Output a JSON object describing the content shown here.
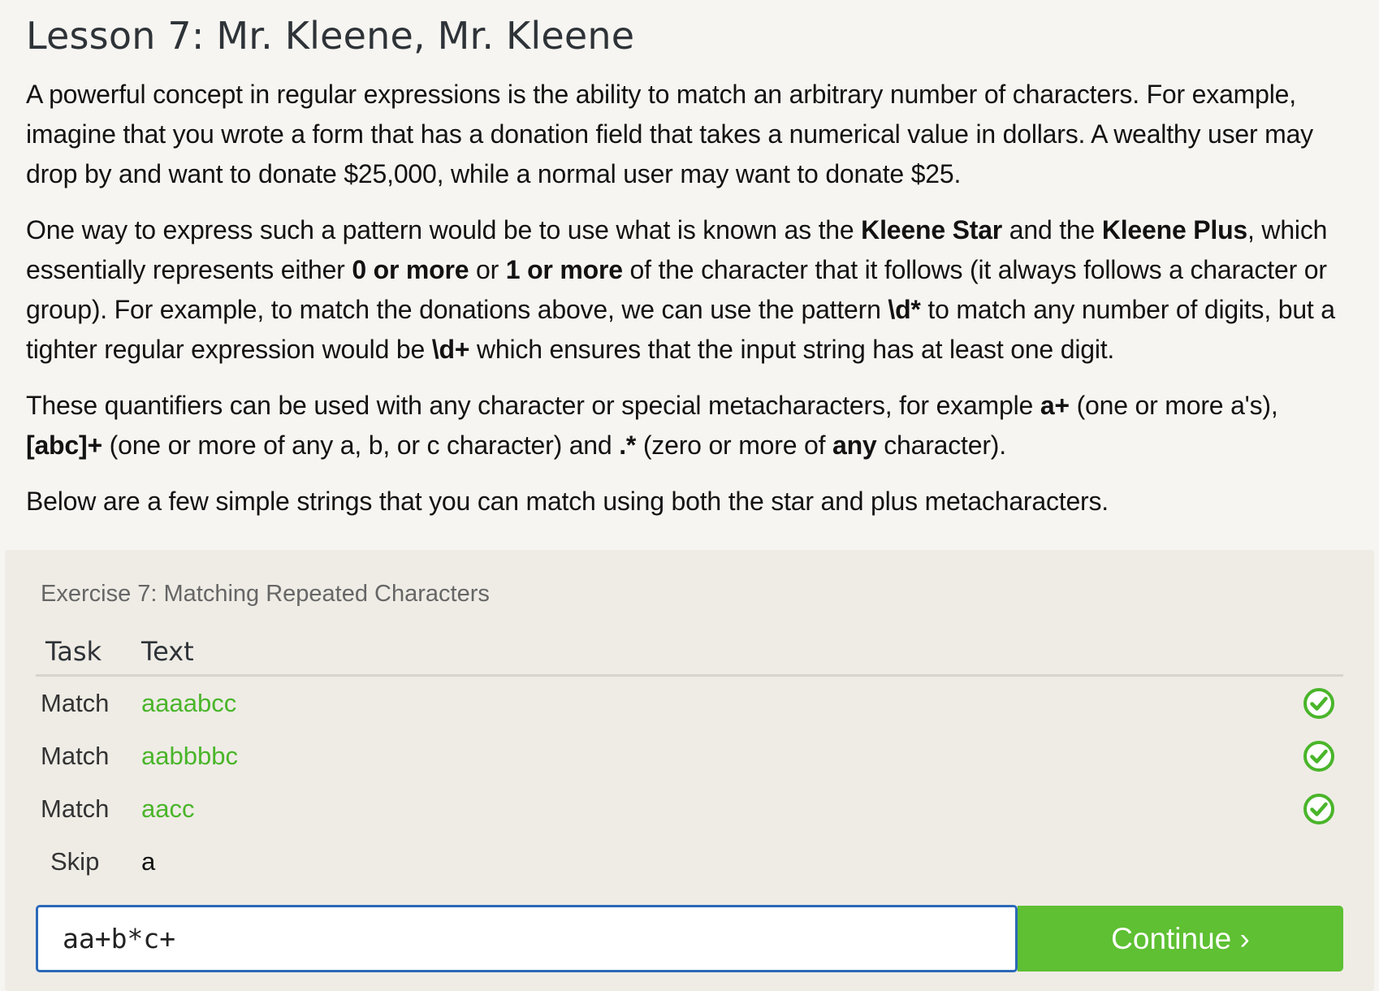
{
  "lesson": {
    "title": "Lesson 7: Mr. Kleene, Mr. Kleene",
    "paragraphs": {
      "p1": "A powerful concept in regular expressions is the ability to match an arbitrary number of characters. For example, imagine that you wrote a form that has a donation field that takes a numerical value in dollars. A wealthy user may drop by and want to donate $25,000, while a normal user may want to donate $25.",
      "p2": {
        "t1": "One way to express such a pattern would be to use what is known as the ",
        "b1": "Kleene Star",
        "t2": " and the ",
        "b2": "Kleene Plus",
        "t3": ", which essentially represents either ",
        "b3": "0 or more",
        "t4": " or ",
        "b4": "1 or more",
        "t5": " of the character that it follows (it always follows a character or group). For example, to match the donations above, we can use the pattern ",
        "b5": "\\d*",
        "t6": " to match any number of digits, but a tighter regular expression would be ",
        "b6": "\\d+",
        "t7": " which ensures that the input string has at least one digit."
      },
      "p3": {
        "t1": "These quantifiers can be used with any character or special metacharacters, for example ",
        "b1": "a+",
        "t2": " (one or more a's), ",
        "b2": "[abc]+",
        "t3": " (one or more of any a, b, or c character) and ",
        "b3": ".*",
        "t4": " (zero or more of ",
        "b4": "any",
        "t5": " character)."
      },
      "p4": "Below are a few simple strings that you can match using both the star and plus metacharacters."
    }
  },
  "exercise": {
    "title": "Exercise 7: Matching Repeated Characters",
    "headers": {
      "task": "Task",
      "text": "Text"
    },
    "rows": [
      {
        "task": "Match",
        "text": "aaaabcc",
        "status": "matched"
      },
      {
        "task": "Match",
        "text": "aabbbbc",
        "status": "matched"
      },
      {
        "task": "Match",
        "text": "aacc",
        "status": "matched"
      },
      {
        "task": "Skip",
        "text": "a",
        "status": "none"
      }
    ],
    "input_value": "aa+b*c+",
    "continue_label": "Continue ›"
  },
  "colors": {
    "match_green": "#4ab52a",
    "button_green": "#5ec032",
    "input_border": "#2b69b8"
  }
}
